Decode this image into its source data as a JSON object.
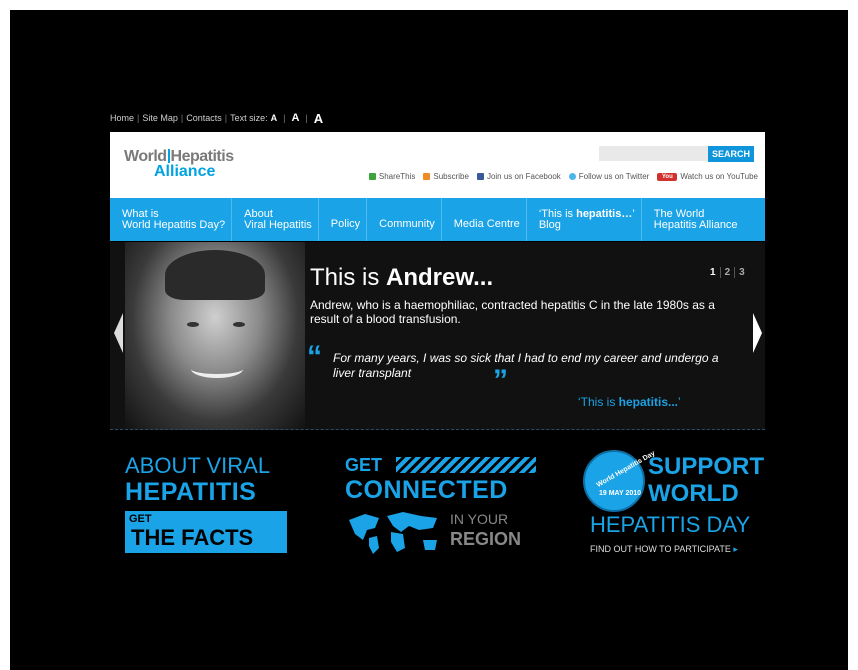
{
  "utility": {
    "home": "Home",
    "sitemap": "Site Map",
    "contacts": "Contacts",
    "textsize_label": "Text size:",
    "size_a1": "A",
    "size_a2": "A",
    "size_a3": "A"
  },
  "logo": {
    "line1_left": "World",
    "line1_right": "Hepatitis",
    "line2": "Alliance"
  },
  "search": {
    "value": "",
    "button": "SEARCH"
  },
  "social": {
    "share": "ShareThis",
    "subscribe": "Subscribe",
    "facebook": "Join us on Facebook",
    "twitter": "Follow us on Twitter",
    "youtube_badge": "You",
    "youtube": "Watch us on YouTube"
  },
  "nav": [
    {
      "line1": "What is",
      "line2": "World Hepatitis Day?"
    },
    {
      "line1": "About",
      "line2": "Viral Hepatitis"
    },
    {
      "line1": "Policy"
    },
    {
      "line1": "Community"
    },
    {
      "line1": "Media Centre"
    },
    {
      "line1_pre": "‘This is ",
      "line1_bold": "hepatitis…",
      "line1_post": "’",
      "line2": "Blog"
    },
    {
      "line1": "The World",
      "line2": "Hepatitis Alliance"
    }
  ],
  "hero": {
    "title_pre": "This is ",
    "title_bold": "Andrew...",
    "pager": [
      "1",
      "2",
      "3"
    ],
    "description": "Andrew, who is a haemophiliac, contracted hepatitis C in the late 1980s as a result of a blood transfusion.",
    "quote_open": "“",
    "quote": "For many years, I was so sick that I had to end my career and undergo a liver transplant",
    "quote_close": "”",
    "tag_pre": "‘This is ",
    "tag_bold": "hepatitis...",
    "tag_post": "’"
  },
  "promos": {
    "about_line1": "ABOUT VIRAL",
    "about_line2": "HEPATITIS",
    "facts_get": "GET",
    "facts_main": "THE FACTS",
    "connect_get": "GET",
    "connect_main": "CONNECTED",
    "region_1": "IN YOUR",
    "region_2": "REGION",
    "badge_top": "World Hepatitis Day",
    "badge_date": "19 MAY 2010",
    "support_1": "SUPPORT",
    "support_2": "WORLD",
    "support_3": "HEPATITIS DAY",
    "participate": "FIND OUT HOW TO PARTICIPATE",
    "participate_chev": "▸"
  },
  "colors": {
    "accent": "#1aa3e6",
    "background": "#000000",
    "header": "#ffffff"
  }
}
